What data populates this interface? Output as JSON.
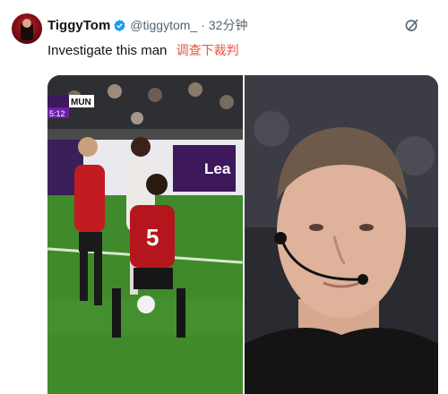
{
  "tweet": {
    "author_name": "TiggyTom",
    "handle": "@tiggytom_",
    "separator": "·",
    "time": "32分钟",
    "text": "Investigate this man",
    "translation": "调查下裁判"
  },
  "icons": {
    "verified": "verified-badge-icon",
    "more": "grok-slash-icon"
  },
  "media": {
    "left_photo": {
      "score_overlay": "MUN",
      "score_time": "5:12",
      "board_text": "Lea",
      "player_number": "5"
    }
  },
  "colors": {
    "verified": "#1d9bf0",
    "translate": "#e8553f",
    "pitch": "#3f8a2a",
    "bournemouth_red": "#c21b22"
  }
}
